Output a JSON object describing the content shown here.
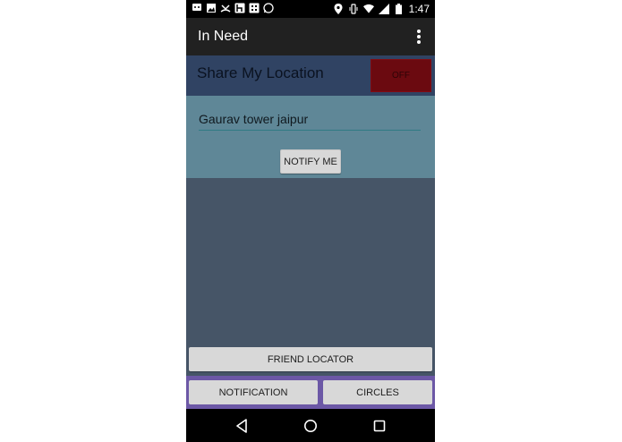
{
  "status_bar": {
    "time": "1:47",
    "left_icons": [
      "chat-icon",
      "image-icon",
      "missed-call-icon",
      "hike-icon",
      "bbm-icon",
      "whatsapp-icon"
    ],
    "right_icons": [
      "location-icon",
      "vibrate-icon",
      "wifi-icon",
      "signal-icon",
      "battery-icon"
    ]
  },
  "app_bar": {
    "title": "In Need",
    "menu_icon": "overflow-menu-icon"
  },
  "share": {
    "label": "Share My Location",
    "toggle_label": "OFF",
    "toggle_color": "#6b0a10"
  },
  "location": {
    "value": "Gaurav tower jaipur",
    "notify_label": "NOTIFY ME"
  },
  "buttons": {
    "friend_locator": "FRIEND LOCATOR",
    "notification": "NOTIFICATION",
    "circles": "CIRCLES"
  },
  "nav": {
    "icons": [
      "back-icon",
      "home-icon",
      "recents-icon"
    ]
  },
  "colors": {
    "app_bar": "#212121",
    "share_row": "#304363",
    "location_panel": "#5f8797",
    "content_bg": "#465567",
    "bottom_bar": "#6c58a6"
  }
}
